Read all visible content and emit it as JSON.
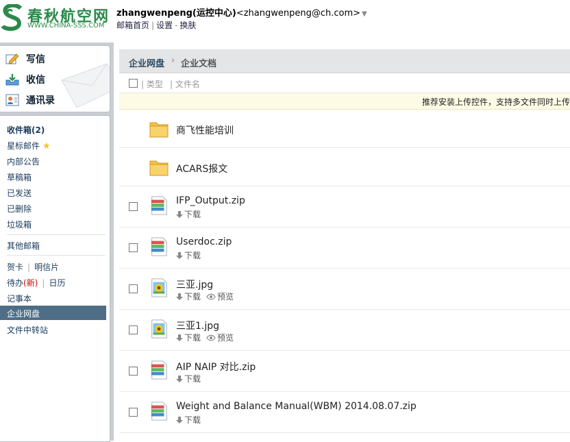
{
  "header": {
    "logo_text": "春秋航空网",
    "logo_url": "WWW.CHINA-SSS.COM",
    "user_name": "zhangwenpeng(运控中心)",
    "user_email": "<zhangwenpeng@ch.com>",
    "links": [
      "邮箱首页",
      "设置",
      "换肤"
    ]
  },
  "compose": {
    "write": "写信",
    "receive": "收信",
    "contacts": "通讯录"
  },
  "folders": {
    "inbox": "收件箱(2)",
    "starred": "星标邮件",
    "notice": "内部公告",
    "drafts": "草稿箱",
    "sent": "已发送",
    "deleted": "已删除",
    "spam": "垃圾箱",
    "other": "其他邮箱",
    "card": "贺卡",
    "postcard": "明信片",
    "todo": "待办",
    "todo_new": "(新)",
    "calendar": "日历",
    "notes": "记事本",
    "netdisk": "企业网盘",
    "transfer": "文件中转站"
  },
  "main": {
    "breadcrumb_root": "企业网盘",
    "breadcrumb_current": "企业文档",
    "col_type": "类型",
    "col_name": "文件名",
    "notice": "推荐安装上传控件，支持多文件同时上传",
    "files": [
      {
        "name": "商飞性能培训",
        "type": "folder"
      },
      {
        "name": "ACARS报文",
        "type": "folder"
      },
      {
        "name": "IFP_Output.zip",
        "type": "zip",
        "download": "下载"
      },
      {
        "name": "Userdoc.zip",
        "type": "zip",
        "download": "下载"
      },
      {
        "name": "三亚.jpg",
        "type": "image",
        "download": "下载",
        "preview": "预览"
      },
      {
        "name": "三亚1.jpg",
        "type": "image",
        "download": "下载",
        "preview": "预览"
      },
      {
        "name": "AIP NAIP 对比.zip",
        "type": "zip",
        "download": "下载"
      },
      {
        "name": "Weight and Balance Manual(WBM) 2014.08.07.zip",
        "type": "zip",
        "download": "下载"
      }
    ]
  },
  "colors": {
    "brand_green": "#2a8a4a",
    "active_item_bg": "#4d6e86",
    "sidebar_bg": "#c9ced3",
    "breadcrumb_bg": "#e3e5e6",
    "notice_bg": "#fdfbe6"
  }
}
